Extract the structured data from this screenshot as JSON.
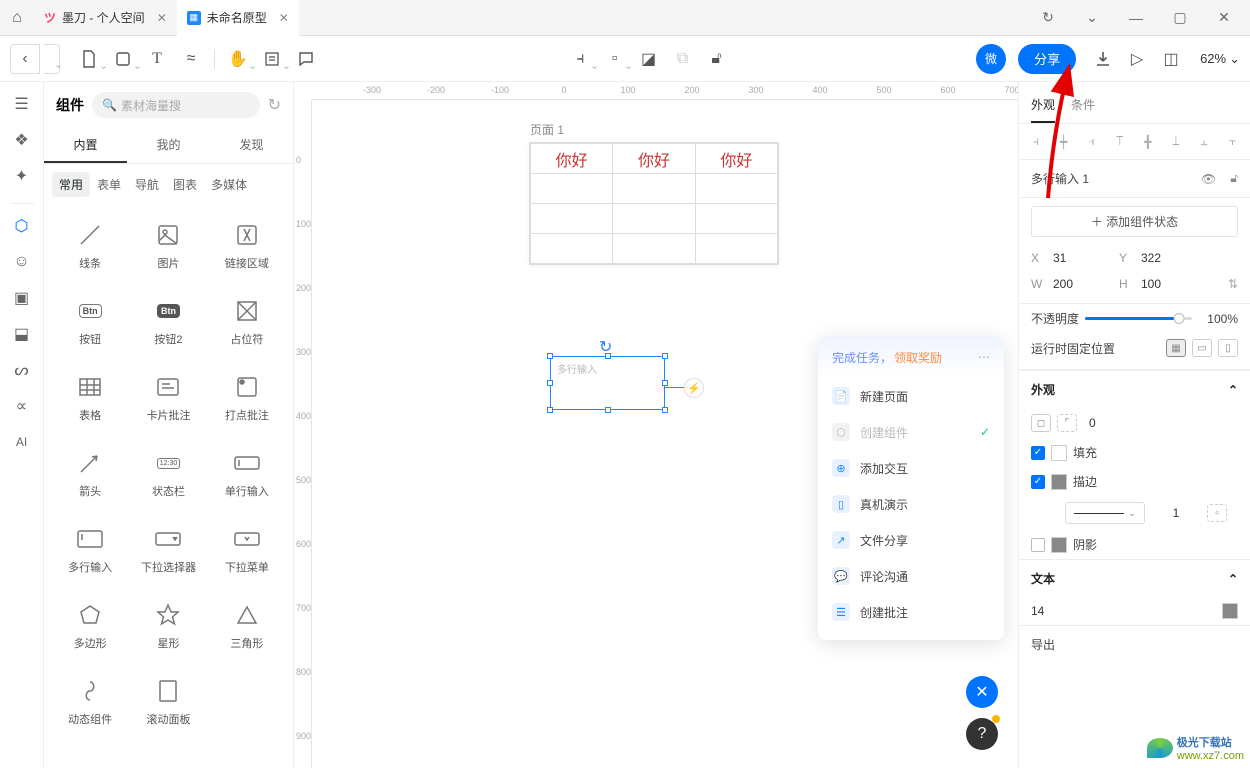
{
  "tabs": {
    "tab1": "墨刀 - 个人空间",
    "tab2": "未命名原型"
  },
  "toolbar": {
    "wei": "微",
    "share": "分享",
    "zoom": "62%"
  },
  "leftPanel": {
    "title": "组件",
    "searchPlaceholder": "素材海量搜",
    "tabs": {
      "builtin": "内置",
      "mine": "我的",
      "discover": "发现"
    },
    "cats": {
      "common": "常用",
      "form": "表单",
      "nav": "导航",
      "chart": "图表",
      "media": "多媒体"
    },
    "items": {
      "line": "线条",
      "image": "图片",
      "link": "链接区域",
      "button": "按钮",
      "button2": "按钮2",
      "placeholder": "占位符",
      "table": "表格",
      "card": "卡片批注",
      "dot": "打点批注",
      "arrow": "箭头",
      "status": "状态栏",
      "singleInput": "单行输入",
      "multiInput": "多行输入",
      "select": "下拉选择器",
      "menu": "下拉菜单",
      "polygon": "多边形",
      "star": "星形",
      "triangle": "三角形",
      "dynamic": "动态组件",
      "scroll": "滚动面板"
    }
  },
  "artboard": {
    "title": "页面 1",
    "cell": "你好",
    "inputPlaceholder": "多行输入"
  },
  "taskPop": {
    "t1": "完成任务，",
    "t2": "领取奖励",
    "newPage": "新建页面",
    "createComp": "创建组件",
    "addInteract": "添加交互",
    "preview": "真机演示",
    "share": "文件分享",
    "comment": "评论沟通",
    "annotate": "创建批注"
  },
  "rightPanel": {
    "tabs": {
      "appearance": "外观",
      "event": "条件"
    },
    "layerName": "多行输入 1",
    "addState": "＋ 添加组件状态",
    "pos": {
      "xLabel": "X",
      "x": "31",
      "yLabel": "Y",
      "y": "322",
      "wLabel": "W",
      "w": "200",
      "hLabel": "H",
      "h": "100"
    },
    "opacityLabel": "不透明度",
    "opacityVal": "100%",
    "fixedLabel": "运行时固定位置",
    "appearanceSection": "外观",
    "radiusVal": "0",
    "fill": "填充",
    "stroke": "描边",
    "strokeWidth": "1",
    "shadow": "阴影",
    "textSection": "文本",
    "fontSize": "14",
    "export": "导出"
  },
  "watermark": {
    "a": "极光下载站",
    "b": "www.xz7.com"
  }
}
